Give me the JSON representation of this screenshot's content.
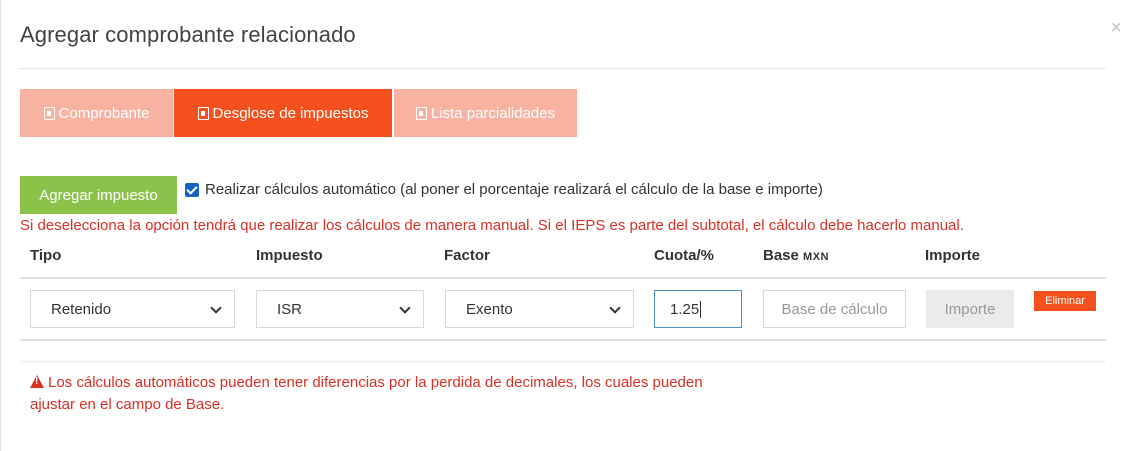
{
  "modal": {
    "title": "Agregar comprobante relacionado",
    "close_glyph": "×"
  },
  "tabs": [
    {
      "label": "Comprobante",
      "icon": "file-icon",
      "active": false
    },
    {
      "label": "Desglose de impuestos",
      "icon": "file-excel-icon",
      "active": true
    },
    {
      "label": "Lista parcialidades",
      "icon": "file-icon",
      "active": false
    }
  ],
  "toolbar": {
    "add_tax_label": "Agregar impuesto",
    "auto_calc_checked": true,
    "auto_calc_label": "Realizar cálculos automático (al poner el porcentaje realizará el cálculo de la base e importe)"
  },
  "warning_text": "Si deselecciona la opción tendrá que realizar los cálculos de manera manual. Si el IEPS es parte del subtotal, el cálculo debe hacerlo manual.",
  "table": {
    "headers": {
      "tipo": "Tipo",
      "impuesto": "Impuesto",
      "factor": "Factor",
      "cuota": "Cuota/%",
      "base": "Base",
      "base_unit": "MXN",
      "importe": "Importe"
    },
    "row": {
      "tipo": "Retenido",
      "impuesto": "ISR",
      "factor": "Exento",
      "cuota": "1.25",
      "base_placeholder": "Base de cálculo",
      "importe_placeholder": "Importe",
      "delete_label": "Eliminar"
    }
  },
  "note": {
    "icon": "warning-icon",
    "text": "Los cálculos automáticos pueden tener diferencias por la perdida de decimales, los cuales pueden ajustar en el campo de Base."
  },
  "colors": {
    "accent": "#f4511e",
    "tab_inactive": "#f7b2a2",
    "success": "#8bc34a",
    "danger_text": "#d93025",
    "checkbox": "#1565c0"
  }
}
